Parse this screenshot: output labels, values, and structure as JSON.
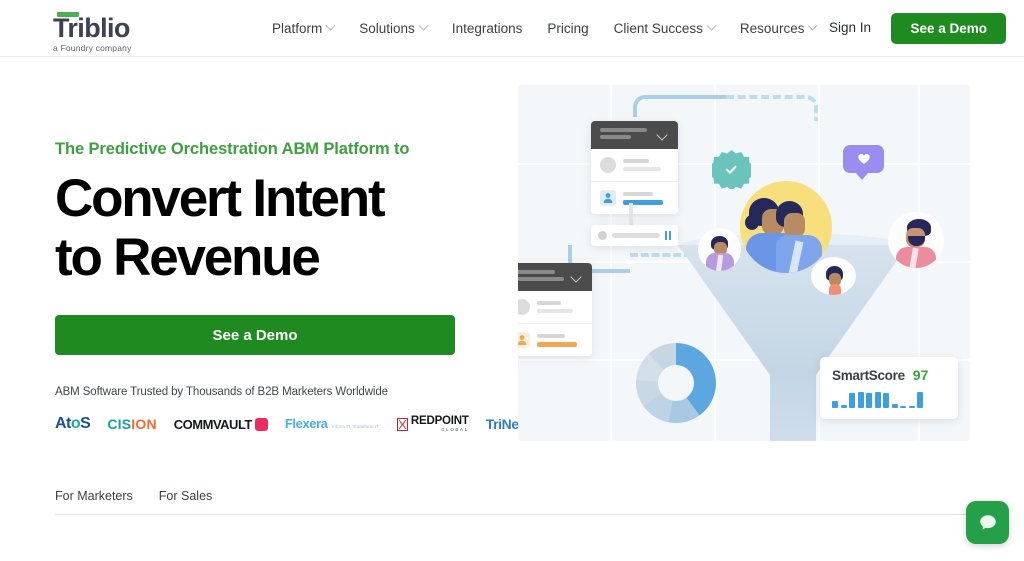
{
  "header": {
    "logo": {
      "name": "Triblio",
      "tagline": "a Foundry company",
      "accent_color": "#4cb04f"
    },
    "nav": [
      {
        "label": "Platform",
        "has_dropdown": true
      },
      {
        "label": "Solutions",
        "has_dropdown": true
      },
      {
        "label": "Integrations",
        "has_dropdown": false
      },
      {
        "label": "Pricing",
        "has_dropdown": false
      },
      {
        "label": "Client Success",
        "has_dropdown": true
      },
      {
        "label": "Resources",
        "has_dropdown": true
      }
    ],
    "sign_in": "Sign In",
    "demo_button": "See a Demo"
  },
  "hero": {
    "eyebrow": "The Predictive Orchestration ABM Platform to",
    "headline_line1": "Convert Intent",
    "headline_line2": "to Revenue",
    "cta": "See a Demo",
    "trust_text": "ABM Software Trusted by Thousands of B2B Marketers Worldwide",
    "logos": [
      {
        "name": "Atos",
        "part1": "At",
        "part2": "o",
        "part3": "S"
      },
      {
        "name": "CISION",
        "part1": "CIS",
        "part2": "ION"
      },
      {
        "name": "COMMVAULT"
      },
      {
        "name": "Flexera",
        "sub": "Inform IT. Transform IT."
      },
      {
        "name": "REDPOINT",
        "sub": "GLOBAL"
      },
      {
        "name": "TriNet"
      }
    ]
  },
  "illustration": {
    "smartscore": {
      "label": "SmartScore",
      "value": "97",
      "value_color": "#3ca03f"
    },
    "sparkline": [
      7,
      3,
      15,
      16,
      15,
      16,
      15,
      4,
      2,
      2,
      16
    ],
    "donut_segments": [
      {
        "value": 40,
        "color": "#5ca7e0"
      },
      {
        "value": 13,
        "color": "#a9c9e3"
      },
      {
        "value": 12,
        "color": "#bdd3e6"
      },
      {
        "value": 11,
        "color": "#c9d8e5"
      },
      {
        "value": 12,
        "color": "#d2dee8"
      },
      {
        "value": 12,
        "color": "#c6d6e4"
      }
    ],
    "badge_color": "#6bc4bb",
    "bubble_color": "#9b8cf0",
    "accent_blue": "#3d9fe0",
    "accent_orange": "#f0a755"
  },
  "tabs": [
    {
      "label": "For Marketers"
    },
    {
      "label": "For Sales"
    }
  ],
  "chat": {
    "label": "chat-bubble-icon",
    "color": "#24a148"
  }
}
